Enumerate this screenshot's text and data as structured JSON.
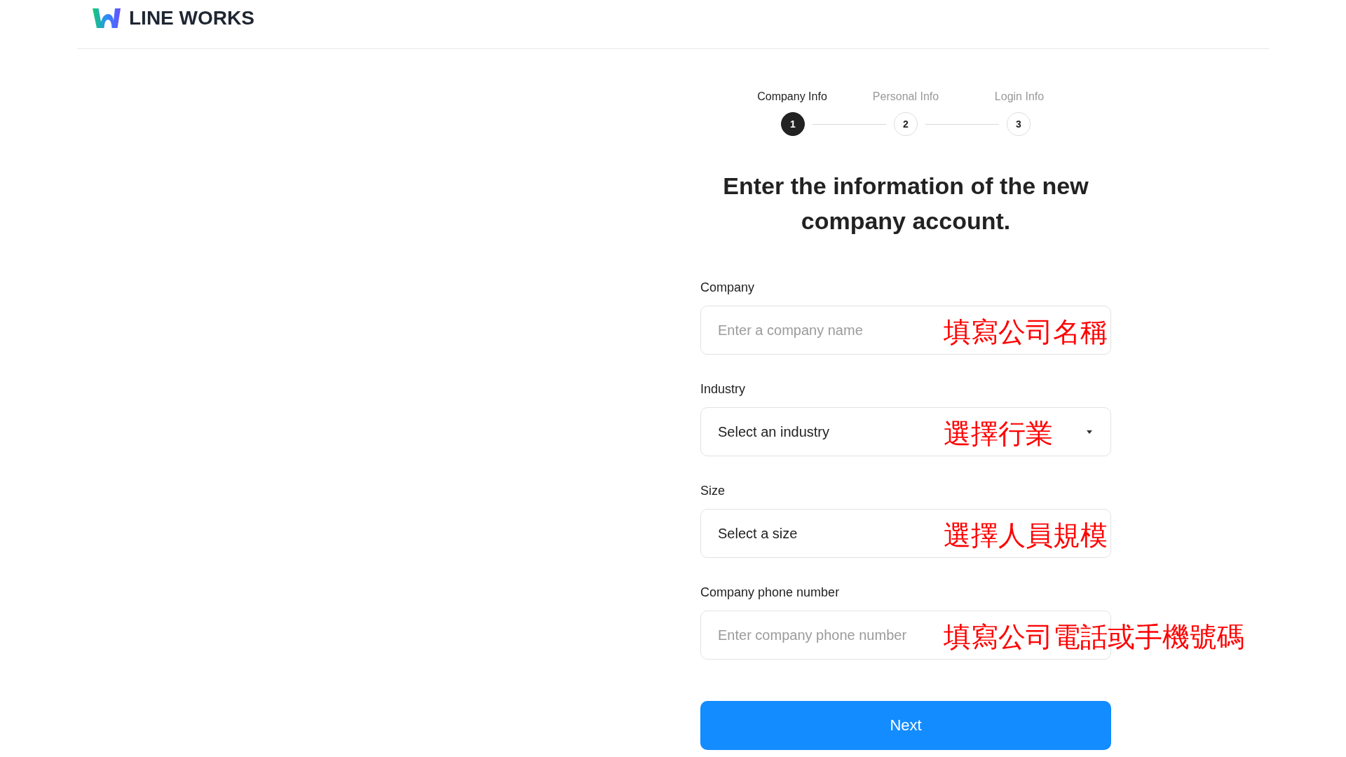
{
  "header": {
    "logo_text": "LINE WORKS"
  },
  "steps": [
    {
      "label": "Company Info",
      "number": "1",
      "selected": true
    },
    {
      "label": "Personal Info",
      "number": "2",
      "selected": false
    },
    {
      "label": "Login Info",
      "number": "3",
      "selected": false
    }
  ],
  "heading": "Enter the information of the new company account.",
  "fields": [
    {
      "kind": "input",
      "label": "Company",
      "placeholder": "Enter a company name",
      "annotation": "填寫公司名稱"
    },
    {
      "kind": "select",
      "label": "Industry",
      "value": "Select an industry",
      "arrow": true,
      "annotation": "選擇行業"
    },
    {
      "kind": "select",
      "label": "Size",
      "value": "Select a size",
      "arrow": false,
      "annotation": "選擇人員規模"
    },
    {
      "kind": "input",
      "label": "Company phone number",
      "placeholder": "Enter company phone number",
      "annotation": "填寫公司電話或手機號碼"
    }
  ],
  "next_button": "Next"
}
